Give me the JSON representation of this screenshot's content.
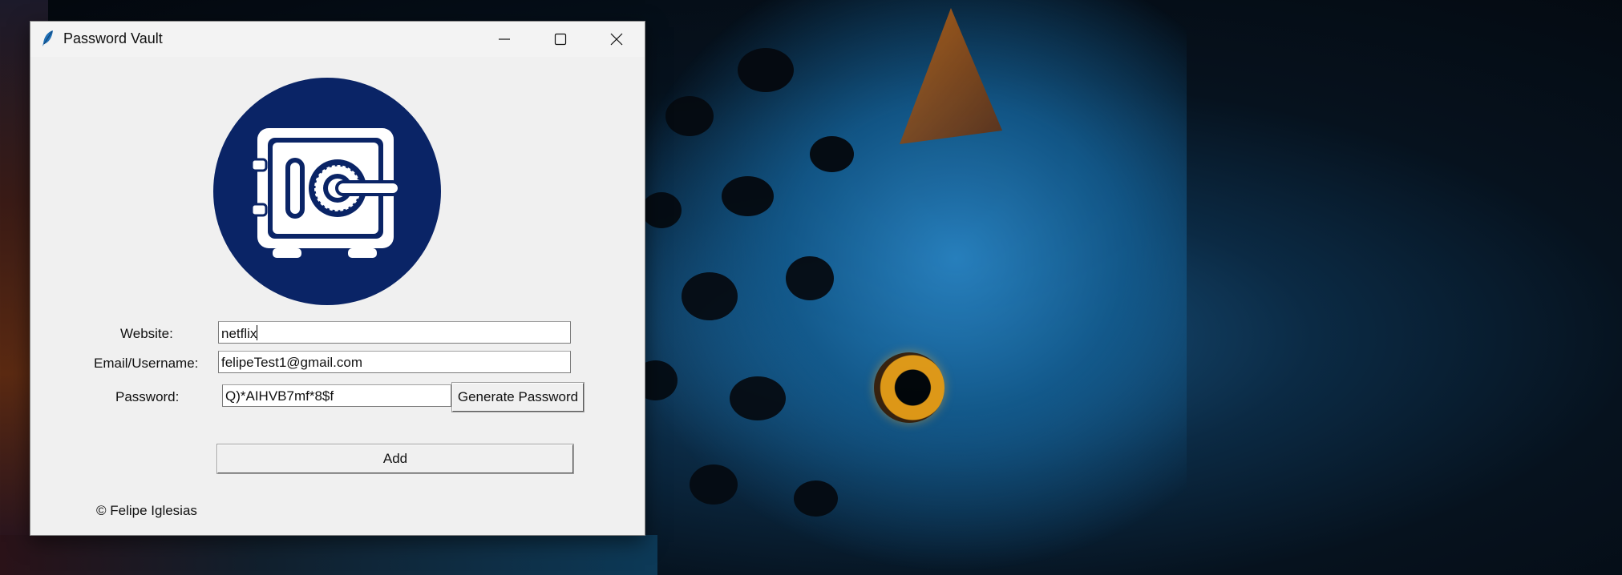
{
  "window": {
    "title": "Password Vault"
  },
  "form": {
    "website_label": "Website:",
    "website_value": "netflix",
    "email_label": "Email/Username:",
    "email_value": "felipeTest1@gmail.com",
    "password_label": "Password:",
    "password_value": "Q)*AIHVB7mf*8$f",
    "generate_label": "Generate Password",
    "add_label": "Add"
  },
  "footer": {
    "text": "© Felipe Iglesias"
  },
  "colors": {
    "logo_bg": "#0a2466",
    "window_bg": "#f0f0f0"
  },
  "icons": {
    "app": "feather-icon",
    "logo": "safe-vault-icon"
  }
}
